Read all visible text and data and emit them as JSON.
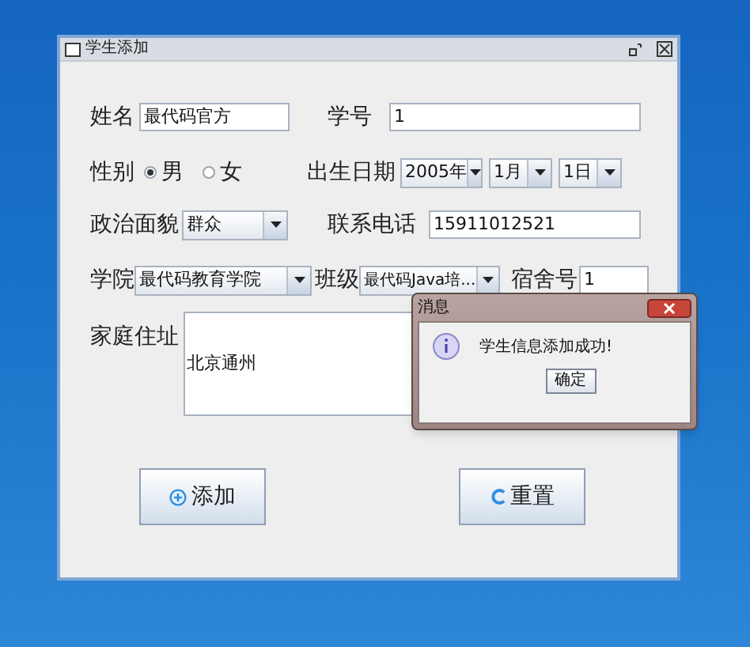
{
  "window": {
    "title": "学生添加"
  },
  "name": {
    "label": "姓名",
    "value": "最代码官方"
  },
  "student_no": {
    "label": "学号",
    "value": "1"
  },
  "gender": {
    "label": "性别",
    "options": [
      {
        "label": "男",
        "selected": true
      },
      {
        "label": "女",
        "selected": false
      }
    ]
  },
  "birth_date": {
    "label": "出生日期",
    "year": "2005年",
    "month": "1月",
    "day": "1日"
  },
  "political_status": {
    "label": "政治面貌",
    "value": "群众"
  },
  "phone": {
    "label": "联系电话",
    "value": "15911012521"
  },
  "college": {
    "label": "学院",
    "value": "最代码教育学院"
  },
  "class": {
    "label": "班级",
    "value": "最代码Java培..."
  },
  "dorm": {
    "label": "宿舍号",
    "value": "1"
  },
  "address": {
    "label": "家庭住址",
    "value": "北京通州"
  },
  "buttons": [
    {
      "label": "添加",
      "kind": "add"
    },
    {
      "label": "重置",
      "kind": "reset"
    }
  ],
  "dialog": {
    "title": "消息",
    "message": "学生信息添加成功!",
    "button": "确定"
  }
}
